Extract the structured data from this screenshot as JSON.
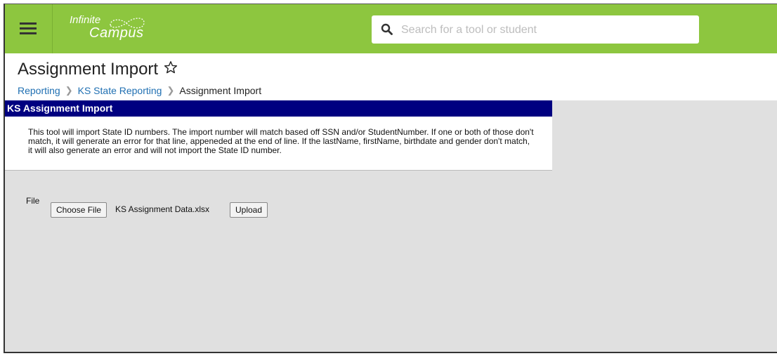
{
  "header": {
    "logo_line1": "Infinite",
    "logo_line2": "Campus",
    "search_placeholder": "Search for a tool or student"
  },
  "page": {
    "title": "Assignment Import",
    "breadcrumb": [
      "Reporting",
      "KS State Reporting",
      "Assignment Import"
    ]
  },
  "panel": {
    "title": "KS Assignment Import",
    "description": "This tool will import State ID numbers. The import number will match based off SSN and/or StudentNumber. If one or both of those don't match, it will generate an error for that line, appeneded at the end of line. If the lastName, firstName, birthdate and gender don't match, it will also generate an error and will not import the State ID number."
  },
  "form": {
    "file_label": "File",
    "choose_file_label": "Choose File",
    "selected_file": "KS Assignment Data.xlsx",
    "upload_label": "Upload"
  },
  "colors": {
    "topbar": "#8dc63f",
    "panel_header": "#000080",
    "link": "#1f6fb2",
    "background": "#e0e0e0"
  },
  "icons": [
    "menu-icon",
    "search-icon",
    "star-icon",
    "chevron-right-icon"
  ]
}
